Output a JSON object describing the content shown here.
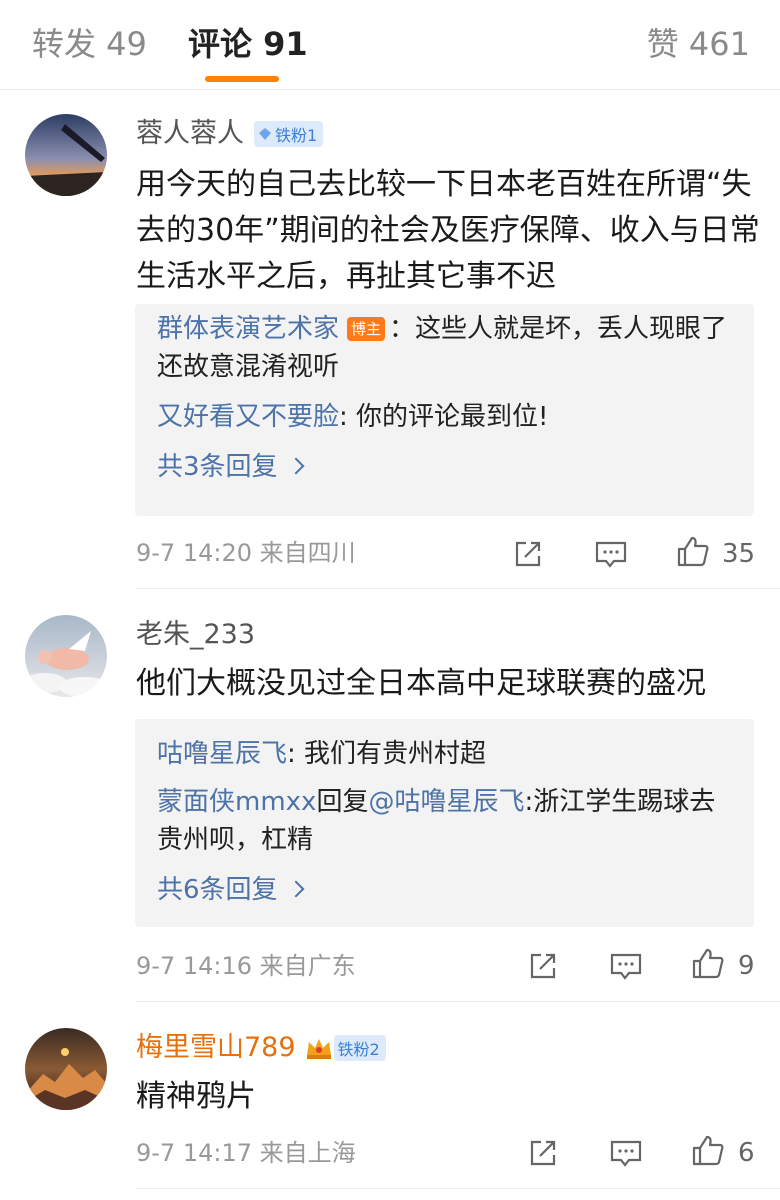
{
  "tabs": {
    "reposts": "转发 49",
    "comments": "评论 91",
    "likes": "赞 461"
  },
  "colors": {
    "accent": "#ff8200",
    "link": "#4d73a8",
    "badge_blue": "#3b7fd6",
    "host_tag": "#ff7a1a"
  },
  "comments": [
    {
      "username": "蓉人蓉人",
      "badge": "铁粉1",
      "text": "用今天的自己去比较一下日本老百姓在所谓“失去的30年”期间的社会及医疗保障、收入与日常生活水平之后，再扯其它事不迟",
      "replies": [
        {
          "name": "群体表演艺术家",
          "tag": "博主",
          "text": "：这些人就是坏，丢人现眼了还故意混淆视听"
        },
        {
          "name": "又好看又不要脸",
          "text": ": 你的评论最到位!"
        }
      ],
      "more": "共3条回复",
      "meta": "9-7 14:20  来自四川",
      "likes": "35",
      "icons": [
        "share-icon",
        "comment-icon",
        "like-icon"
      ]
    },
    {
      "username": "老朱_233",
      "text": "他们大概没见过全日本高中足球联赛的盛况",
      "replies": [
        {
          "name": "咕噜星辰飞",
          "text": ": 我们有贵州村超"
        },
        {
          "name": "蒙面侠mmxx",
          "mid": "回复",
          "name2": "@咕噜星辰飞",
          "text": ":浙江学生踢球去贵州呗，杠精"
        }
      ],
      "more": "共6条回复",
      "meta": "9-7 14:16  来自广东",
      "likes": "9"
    },
    {
      "username": "梅里雪山789",
      "badge": "铁粉2",
      "text": "精神鸦片",
      "meta": "9-7 14:17  来自上海",
      "likes": "6"
    }
  ]
}
